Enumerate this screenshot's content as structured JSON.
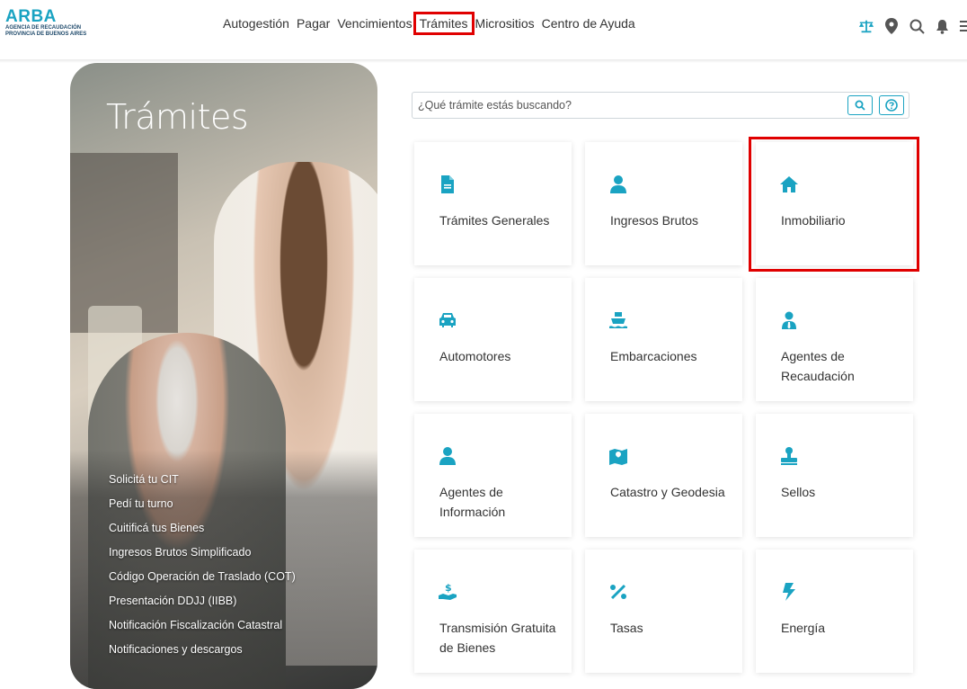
{
  "header": {
    "logo_main": "ARBA",
    "logo_sub_1": "AGENCIA DE RECAUDACIÓN",
    "logo_sub_2": "PROVINCIA DE BUENOS AIRES",
    "nav": [
      "Autogestión",
      "Pagar",
      "Vencimientos",
      "Trámites",
      "Micrositios",
      "Centro de Ayuda"
    ],
    "highlighted_nav": "Trámites",
    "icons": [
      "balance-scale-icon",
      "location-pin-icon",
      "search-icon",
      "bell-icon",
      "menu-icon"
    ]
  },
  "hero": {
    "title": "Trámites",
    "links": [
      "Solicitá tu CIT",
      "Pedí tu turno",
      "Cuitificá tus Bienes",
      "Ingresos Brutos Simplificado",
      "Código Operación de Traslado (COT)",
      "Presentación DDJJ (IIBB)",
      "Notificación Fiscalización Catastral",
      "Notificaciones y descargos"
    ]
  },
  "search": {
    "placeholder": "¿Qué trámite estás buscando?",
    "icons": [
      "search-icon",
      "help-icon"
    ]
  },
  "cards": [
    {
      "label": "Trámites Generales",
      "icon": "document-icon"
    },
    {
      "label": "Ingresos Brutos",
      "icon": "person-icon"
    },
    {
      "label": "Inmobiliario",
      "icon": "house-icon"
    },
    {
      "label": "Automotores",
      "icon": "car-icon"
    },
    {
      "label": "Embarcaciones",
      "icon": "ship-icon"
    },
    {
      "label": "Agentes de Recaudación",
      "icon": "agent-icon"
    },
    {
      "label": "Agentes de Información",
      "icon": "person-icon"
    },
    {
      "label": "Catastro y Geodesia",
      "icon": "map-icon"
    },
    {
      "label": "Sellos",
      "icon": "stamp-icon"
    },
    {
      "label": "Transmisión Gratuita de Bienes",
      "icon": "hand-money-icon"
    },
    {
      "label": "Tasas",
      "icon": "percent-icon"
    },
    {
      "label": "Energía",
      "icon": "bolt-icon"
    }
  ],
  "colors": {
    "accent": "#1aa3c2",
    "highlight": "#e00000"
  }
}
